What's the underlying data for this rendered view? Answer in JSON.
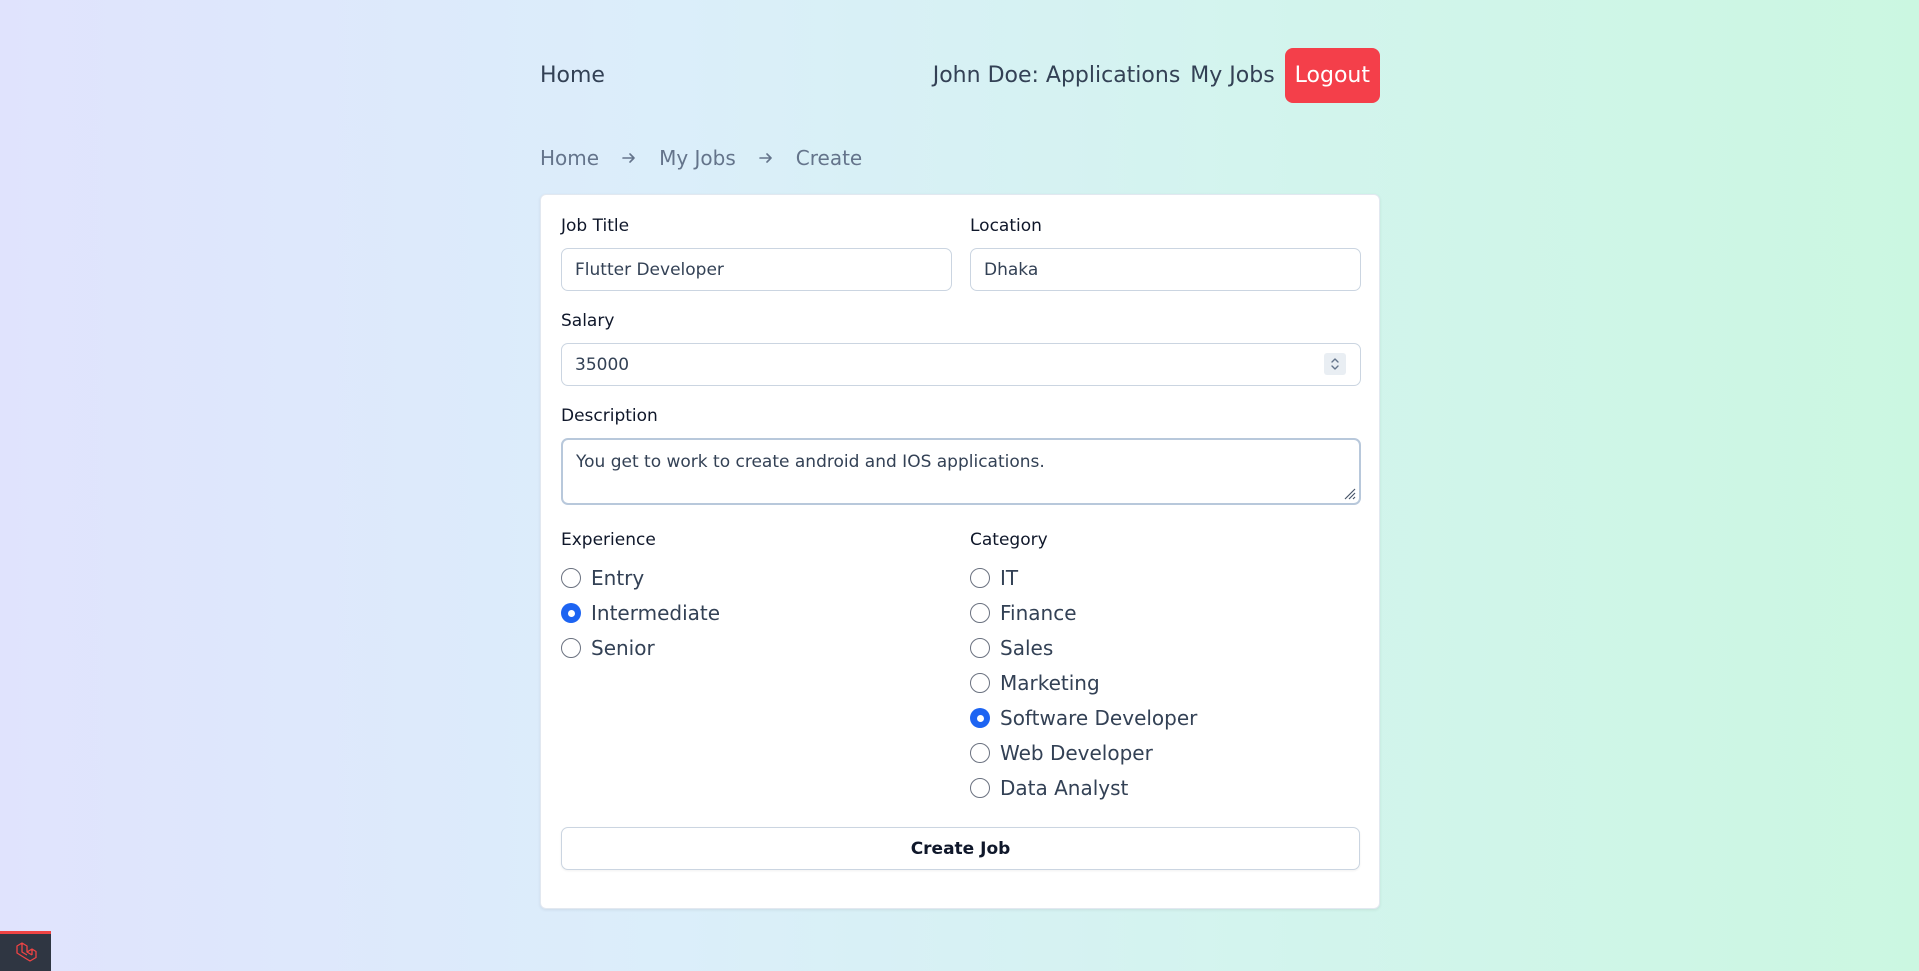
{
  "nav": {
    "home": "Home",
    "applications": "John Doe: Applications",
    "my_jobs": "My Jobs",
    "logout": "Logout"
  },
  "breadcrumb": {
    "items": [
      "Home",
      "My Jobs",
      "Create"
    ]
  },
  "form": {
    "title_label": "Job Title",
    "title_value": "Flutter Developer",
    "location_label": "Location",
    "location_value": "Dhaka",
    "salary_label": "Salary",
    "salary_value": "35000",
    "description_label": "Description",
    "description_value": "You get to work to create android and IOS applications.",
    "experience_label": "Experience",
    "experience_options": [
      "Entry",
      "Intermediate",
      "Senior"
    ],
    "experience_selected": "Intermediate",
    "category_label": "Category",
    "category_options": [
      "IT",
      "Finance",
      "Sales",
      "Marketing",
      "Software Developer",
      "Web Developer",
      "Data Analyst"
    ],
    "category_selected": "Software Developer",
    "submit_label": "Create Job"
  },
  "colors": {
    "logout_bg": "#f43f4a",
    "radio_checked": "#1d64f2",
    "text": "#334155"
  },
  "icons": {
    "breadcrumb_separator": "arrow-right-icon",
    "stepper": "chevron-up-down-icon",
    "badge": "laravel-logo-icon"
  }
}
